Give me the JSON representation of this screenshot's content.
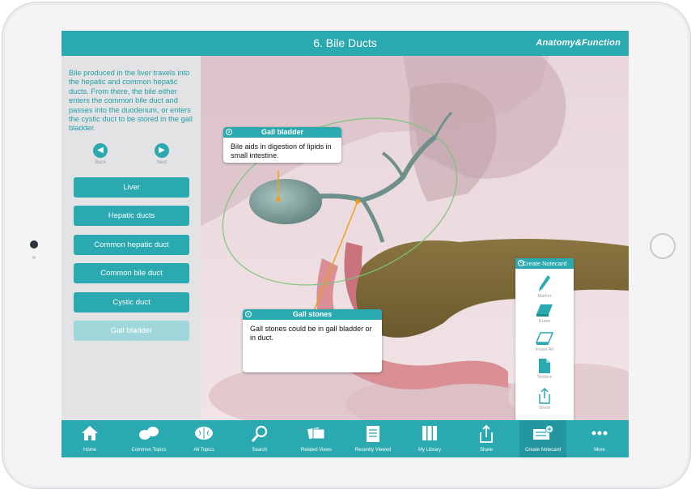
{
  "header": {
    "title": "6. Bile Ducts",
    "brand": "Anatomy&Function"
  },
  "sidebar": {
    "intro": "Bile produced in the liver travels into the hepatic and common hepatic ducts. From there, the bile either enters the common bile duct and passes into the duodenum, or enters the cystic duct to be stored in the gall bladder.",
    "back_label": "Back",
    "next_label": "Next",
    "topics": [
      {
        "label": "Liver"
      },
      {
        "label": "Hepatic ducts"
      },
      {
        "label": "Common hepatic duct"
      },
      {
        "label": "Common bile duct"
      },
      {
        "label": "Cystic duct"
      },
      {
        "label": "Gall bladder"
      }
    ],
    "active_topic": "Gall bladder"
  },
  "popups": {
    "gall_bladder": {
      "title": "Gall bladder",
      "body": "Bile aids in digestion of lipids in small intestine."
    },
    "gall_stones": {
      "title": "Gall stones",
      "body": "Gall stones could be in gall bladder or in duct."
    }
  },
  "notecard_panel": {
    "title": "Create Notecard",
    "tools": [
      {
        "label": "Marker",
        "icon": "pencil-icon"
      },
      {
        "label": "Erase",
        "icon": "eraser-icon"
      },
      {
        "label": "Erase All",
        "icon": "erase-all-icon"
      },
      {
        "label": "Textbox",
        "icon": "textbox-icon"
      },
      {
        "label": "Share",
        "icon": "share-icon"
      }
    ]
  },
  "toolbar": {
    "items": [
      {
        "label": "Home",
        "icon": "home-icon"
      },
      {
        "label": "Common Topics",
        "icon": "topics-icon"
      },
      {
        "label": "All Topics",
        "icon": "brain-icon"
      },
      {
        "label": "Search",
        "icon": "search-icon"
      },
      {
        "label": "Related Views",
        "icon": "related-views-icon"
      },
      {
        "label": "Recently Viewed",
        "icon": "recent-icon"
      },
      {
        "label": "My Library",
        "icon": "library-icon"
      },
      {
        "label": "Share",
        "icon": "share-icon"
      },
      {
        "label": "Create Notecard",
        "icon": "notecard-icon"
      },
      {
        "label": "More",
        "icon": "more-icon"
      }
    ],
    "selected": "Create Notecard"
  },
  "colors": {
    "accent": "#2aa9b0",
    "accent_light": "#9fd7da",
    "panel_bg": "#e3e3e5"
  }
}
